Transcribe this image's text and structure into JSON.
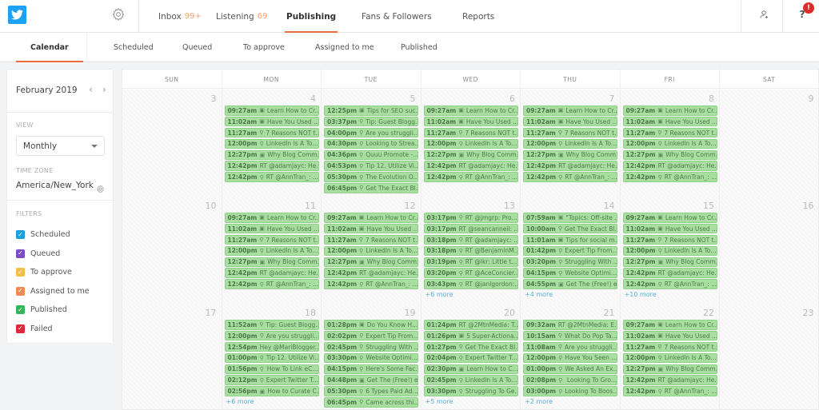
{
  "header": {
    "logo": "twitter-logo",
    "settings_icon": "gear-icon",
    "nav": [
      {
        "label": "Inbox",
        "badge": "99+"
      },
      {
        "label": "Listening",
        "badge": "69"
      },
      {
        "label": "Publishing",
        "badge": ""
      },
      {
        "label": "Fans & Followers",
        "badge": ""
      },
      {
        "label": "Reports",
        "badge": ""
      }
    ],
    "active_nav": "Publishing",
    "add_user_icon": "add-user-icon",
    "help_icon": "?",
    "alert_badge": "!"
  },
  "subnav": {
    "tabs": [
      "Calendar",
      "Scheduled",
      "Queued",
      "To approve",
      "Assigned to me",
      "Published"
    ],
    "active": "Calendar"
  },
  "sidebar": {
    "month": "February 2019",
    "prev": "‹",
    "next": "›",
    "view_label": "VIEW",
    "view_value": "Monthly",
    "timezone_label": "TIME ZONE",
    "timezone_value": "America/New_York",
    "filters_label": "FILTERS",
    "filters": [
      {
        "label": "Scheduled",
        "color": "#1a9fe0",
        "checked": true
      },
      {
        "label": "Queued",
        "color": "#7b4bc9",
        "checked": true
      },
      {
        "label": "To approve",
        "color": "#f2c04a",
        "checked": true
      },
      {
        "label": "Assigned to me",
        "color": "#f08a55",
        "checked": true
      },
      {
        "label": "Published",
        "color": "#33b55a",
        "checked": true
      },
      {
        "label": "Failed",
        "color": "#e0283a",
        "checked": true
      }
    ]
  },
  "calendar": {
    "days_of_week": [
      "SUN",
      "MON",
      "TUE",
      "WED",
      "THU",
      "FRI",
      "SAT"
    ],
    "post_color": "#a8dfa0",
    "weeks": [
      {
        "days": [
          {
            "num": "3",
            "posts": [],
            "more": ""
          },
          {
            "num": "4",
            "posts": [
              {
                "time": "09:27am",
                "icon": "image",
                "text": "Learn How to Cr..."
              },
              {
                "time": "11:02am",
                "icon": "image",
                "text": "Have You Used ..."
              },
              {
                "time": "11:27am",
                "icon": "link",
                "text": "7 Reasons NOT t..."
              },
              {
                "time": "12:00pm",
                "icon": "link",
                "text": "LinkedIn Is A To..."
              },
              {
                "time": "12:27pm",
                "icon": "image",
                "text": "Why Blog Comm..."
              },
              {
                "time": "12:42pm",
                "icon": "",
                "text": "RT @adamjayc: He..."
              },
              {
                "time": "12:42pm",
                "icon": "link",
                "text": "RT @AnnTran_: ..."
              }
            ],
            "more": ""
          },
          {
            "num": "5",
            "posts": [
              {
                "time": "12:25pm",
                "icon": "image",
                "text": "Tips for SEO suc..."
              },
              {
                "time": "03:37pm",
                "icon": "link",
                "text": "Tip: Guest Blogg..."
              },
              {
                "time": "04:00pm",
                "icon": "link",
                "text": "Are you struggli..."
              },
              {
                "time": "04:30pm",
                "icon": "link",
                "text": "Looking to Strea..."
              },
              {
                "time": "04:36pm",
                "icon": "link",
                "text": "Quuu Promote -..."
              },
              {
                "time": "04:53pm",
                "icon": "link",
                "text": "Tip 12. Utilize Vi..."
              },
              {
                "time": "05:30pm",
                "icon": "link",
                "text": "The Evolution O..."
              },
              {
                "time": "06:45pm",
                "icon": "link",
                "text": "Get The Exact Bl..."
              }
            ],
            "more": ""
          },
          {
            "num": "6",
            "posts": [
              {
                "time": "09:27am",
                "icon": "image",
                "text": "Learn How to Cr..."
              },
              {
                "time": "11:02am",
                "icon": "image",
                "text": "Have You Used ..."
              },
              {
                "time": "11:27am",
                "icon": "link",
                "text": "7 Reasons NOT t..."
              },
              {
                "time": "12:00pm",
                "icon": "link",
                "text": "LinkedIn Is A To..."
              },
              {
                "time": "12:27pm",
                "icon": "image",
                "text": "Why Blog Comm..."
              },
              {
                "time": "12:42pm",
                "icon": "",
                "text": "RT @adamjayc: He..."
              },
              {
                "time": "12:42pm",
                "icon": "link",
                "text": "RT @AnnTran_: ..."
              }
            ],
            "more": ""
          },
          {
            "num": "7",
            "posts": [
              {
                "time": "09:27am",
                "icon": "image",
                "text": "Learn How to Cr..."
              },
              {
                "time": "11:02am",
                "icon": "image",
                "text": "Have You Used ..."
              },
              {
                "time": "11:27am",
                "icon": "link",
                "text": "7 Reasons NOT t..."
              },
              {
                "time": "12:00pm",
                "icon": "link",
                "text": "LinkedIn Is A To..."
              },
              {
                "time": "12:27pm",
                "icon": "image",
                "text": "Why Blog Comm..."
              },
              {
                "time": "12:42pm",
                "icon": "",
                "text": "RT @adamjayc: He..."
              },
              {
                "time": "12:42pm",
                "icon": "link",
                "text": "RT @AnnTran_: ..."
              }
            ],
            "more": ""
          },
          {
            "num": "8",
            "posts": [
              {
                "time": "09:27am",
                "icon": "image",
                "text": "Learn How to Cr..."
              },
              {
                "time": "11:02am",
                "icon": "image",
                "text": "Have You Used ..."
              },
              {
                "time": "11:27am",
                "icon": "link",
                "text": "7 Reasons NOT t..."
              },
              {
                "time": "12:00pm",
                "icon": "link",
                "text": "LinkedIn Is A To..."
              },
              {
                "time": "12:27pm",
                "icon": "image",
                "text": "Why Blog Comm..."
              },
              {
                "time": "12:42pm",
                "icon": "",
                "text": "RT @adamjayc: He..."
              },
              {
                "time": "12:42pm",
                "icon": "link",
                "text": "RT @AnnTran_: ..."
              }
            ],
            "more": ""
          },
          {
            "num": "9",
            "posts": [],
            "more": ""
          }
        ]
      },
      {
        "days": [
          {
            "num": "10",
            "posts": [],
            "more": ""
          },
          {
            "num": "11",
            "posts": [
              {
                "time": "09:27am",
                "icon": "image",
                "text": "Learn How to Cr..."
              },
              {
                "time": "11:02am",
                "icon": "image",
                "text": "Have You Used ..."
              },
              {
                "time": "11:27am",
                "icon": "link",
                "text": "7 Reasons NOT t..."
              },
              {
                "time": "12:00pm",
                "icon": "link",
                "text": "LinkedIn Is A To..."
              },
              {
                "time": "12:27pm",
                "icon": "image",
                "text": "Why Blog Comm..."
              },
              {
                "time": "12:42pm",
                "icon": "",
                "text": "RT @adamjayc: He..."
              },
              {
                "time": "12:42pm",
                "icon": "link",
                "text": "RT @AnnTran_: ..."
              }
            ],
            "more": ""
          },
          {
            "num": "12",
            "posts": [
              {
                "time": "09:27am",
                "icon": "image",
                "text": "Learn How to Cr..."
              },
              {
                "time": "11:02am",
                "icon": "image",
                "text": "Have You Used ..."
              },
              {
                "time": "11:27am",
                "icon": "link",
                "text": "7 Reasons NOT t..."
              },
              {
                "time": "12:00pm",
                "icon": "link",
                "text": "LinkedIn Is A To..."
              },
              {
                "time": "12:27pm",
                "icon": "image",
                "text": "Why Blog Comm..."
              },
              {
                "time": "12:42pm",
                "icon": "",
                "text": "RT @adamjayc: He..."
              },
              {
                "time": "12:42pm",
                "icon": "link",
                "text": "RT @AnnTran_: ..."
              }
            ],
            "more": ""
          },
          {
            "num": "13",
            "posts": [
              {
                "time": "03:17pm",
                "icon": "link",
                "text": "RT @jmgrp: Pro..."
              },
              {
                "time": "03:17pm",
                "icon": "",
                "text": "RT @seancanneil: ..."
              },
              {
                "time": "03:18pm",
                "icon": "link",
                "text": "RT @adamjayc: ..."
              },
              {
                "time": "03:18pm",
                "icon": "link",
                "text": "RT @BenjaminM..."
              },
              {
                "time": "03:19pm",
                "icon": "link",
                "text": "RT @lkr: Little t..."
              },
              {
                "time": "03:20pm",
                "icon": "link",
                "text": "RT @AceConcier..."
              },
              {
                "time": "03:43pm",
                "icon": "link",
                "text": "RT @janlgordon:..."
              }
            ],
            "more": "+6 more"
          },
          {
            "num": "14",
            "posts": [
              {
                "time": "07:59am",
                "icon": "image",
                "text": "\"Topics: Off-site ..."
              },
              {
                "time": "10:00am",
                "icon": "link",
                "text": "Get The Exact Bl..."
              },
              {
                "time": "11:01am",
                "icon": "image",
                "text": "Tips for social m..."
              },
              {
                "time": "01:42pm",
                "icon": "link",
                "text": "Expert Tip From..."
              },
              {
                "time": "03:20pm",
                "icon": "link",
                "text": "Struggling With ..."
              },
              {
                "time": "04:15pm",
                "icon": "link",
                "text": "Website Optimi..."
              },
              {
                "time": "04:55pm",
                "icon": "image",
                "text": "Get The (Free!) e..."
              }
            ],
            "more": "+4 more"
          },
          {
            "num": "15",
            "posts": [
              {
                "time": "09:27am",
                "icon": "image",
                "text": "Learn How to Cr..."
              },
              {
                "time": "11:02am",
                "icon": "image",
                "text": "Have You Used ..."
              },
              {
                "time": "11:27am",
                "icon": "link",
                "text": "7 Reasons NOT t..."
              },
              {
                "time": "12:00pm",
                "icon": "link",
                "text": "LinkedIn Is A To..."
              },
              {
                "time": "12:27pm",
                "icon": "image",
                "text": "Why Blog Comm..."
              },
              {
                "time": "12:42pm",
                "icon": "",
                "text": "RT @adamjayc: He..."
              },
              {
                "time": "12:42pm",
                "icon": "link",
                "text": "RT @AnnTran_: ..."
              }
            ],
            "more": "+10 more"
          },
          {
            "num": "16",
            "posts": [],
            "more": ""
          }
        ]
      },
      {
        "days": [
          {
            "num": "17",
            "posts": [],
            "more": ""
          },
          {
            "num": "18",
            "posts": [
              {
                "time": "11:52am",
                "icon": "link",
                "text": "Tip: Guest Blogg..."
              },
              {
                "time": "12:00pm",
                "icon": "link",
                "text": "Are you struggli..."
              },
              {
                "time": "12:54pm",
                "icon": "",
                "text": "Hey @MariBlogger..."
              },
              {
                "time": "01:00pm",
                "icon": "link",
                "text": "Tip 12. Utilize Vi..."
              },
              {
                "time": "01:56pm",
                "icon": "link",
                "text": "How To Link eC..."
              },
              {
                "time": "02:12pm",
                "icon": "link",
                "text": "Expert Twitter T..."
              },
              {
                "time": "02:56pm",
                "icon": "image",
                "text": "How to Curate C..."
              }
            ],
            "more": "+6 more"
          },
          {
            "num": "19",
            "posts": [
              {
                "time": "01:28pm",
                "icon": "image",
                "text": "Do You Know H..."
              },
              {
                "time": "02:02pm",
                "icon": "link",
                "text": "Expert Tip From..."
              },
              {
                "time": "02:45pm",
                "icon": "link",
                "text": "Struggling With ..."
              },
              {
                "time": "03:30pm",
                "icon": "link",
                "text": "Website Optimi..."
              },
              {
                "time": "04:15pm",
                "icon": "link",
                "text": "Here's Some Fac..."
              },
              {
                "time": "04:48pm",
                "icon": "image",
                "text": "Get The (Free!) e..."
              },
              {
                "time": "05:30pm",
                "icon": "link",
                "text": "6 Types Paid Ad..."
              },
              {
                "time": "06:45pm",
                "icon": "link",
                "text": "Came across thi..."
              }
            ],
            "more": ""
          },
          {
            "num": "20",
            "posts": [
              {
                "time": "01:24pm",
                "icon": "",
                "text": "RT @2MtnMedia: T..."
              },
              {
                "time": "01:26pm",
                "icon": "image",
                "text": "5 Super-Actiona..."
              },
              {
                "time": "01:27pm",
                "icon": "link",
                "text": "Get The Exact Bl..."
              },
              {
                "time": "02:04pm",
                "icon": "link",
                "text": "Expert Twitter T..."
              },
              {
                "time": "02:30pm",
                "icon": "image",
                "text": "Learn How to C..."
              },
              {
                "time": "02:45pm",
                "icon": "link",
                "text": "LinkedIn Is A To..."
              },
              {
                "time": "03:30pm",
                "icon": "link",
                "text": "Struggling To Ge..."
              }
            ],
            "more": "+5 more"
          },
          {
            "num": "21",
            "posts": [
              {
                "time": "09:32am",
                "icon": "",
                "text": "RT @2MtnMedia: E..."
              },
              {
                "time": "10:15am",
                "icon": "link",
                "text": "What Do Pop Ta..."
              },
              {
                "time": "11:08am",
                "icon": "link",
                "text": "Are you struggli..."
              },
              {
                "time": "12:00pm",
                "icon": "link",
                "text": "Have You Seen ..."
              },
              {
                "time": "01:00pm",
                "icon": "link",
                "text": "We Asked An Ex..."
              },
              {
                "time": "02:08pm",
                "icon": "link",
                "text": "Looking To Gro..."
              },
              {
                "time": "03:00pm",
                "icon": "link",
                "text": "Looking To Boos..."
              }
            ],
            "more": "+2 more"
          },
          {
            "num": "22",
            "posts": [
              {
                "time": "09:27am",
                "icon": "image",
                "text": "Learn How to Cr..."
              },
              {
                "time": "11:02am",
                "icon": "image",
                "text": "Have You Used ..."
              },
              {
                "time": "11:27am",
                "icon": "link",
                "text": "7 Reasons NOT t..."
              },
              {
                "time": "12:00pm",
                "icon": "link",
                "text": "LinkedIn Is A To..."
              },
              {
                "time": "12:27pm",
                "icon": "image",
                "text": "Why Blog Comm..."
              },
              {
                "time": "12:42pm",
                "icon": "",
                "text": "RT @adamjayc: He..."
              },
              {
                "time": "12:42pm",
                "icon": "link",
                "text": "RT @AnnTran_: ..."
              }
            ],
            "more": ""
          },
          {
            "num": "23",
            "posts": [],
            "more": ""
          }
        ]
      }
    ]
  }
}
